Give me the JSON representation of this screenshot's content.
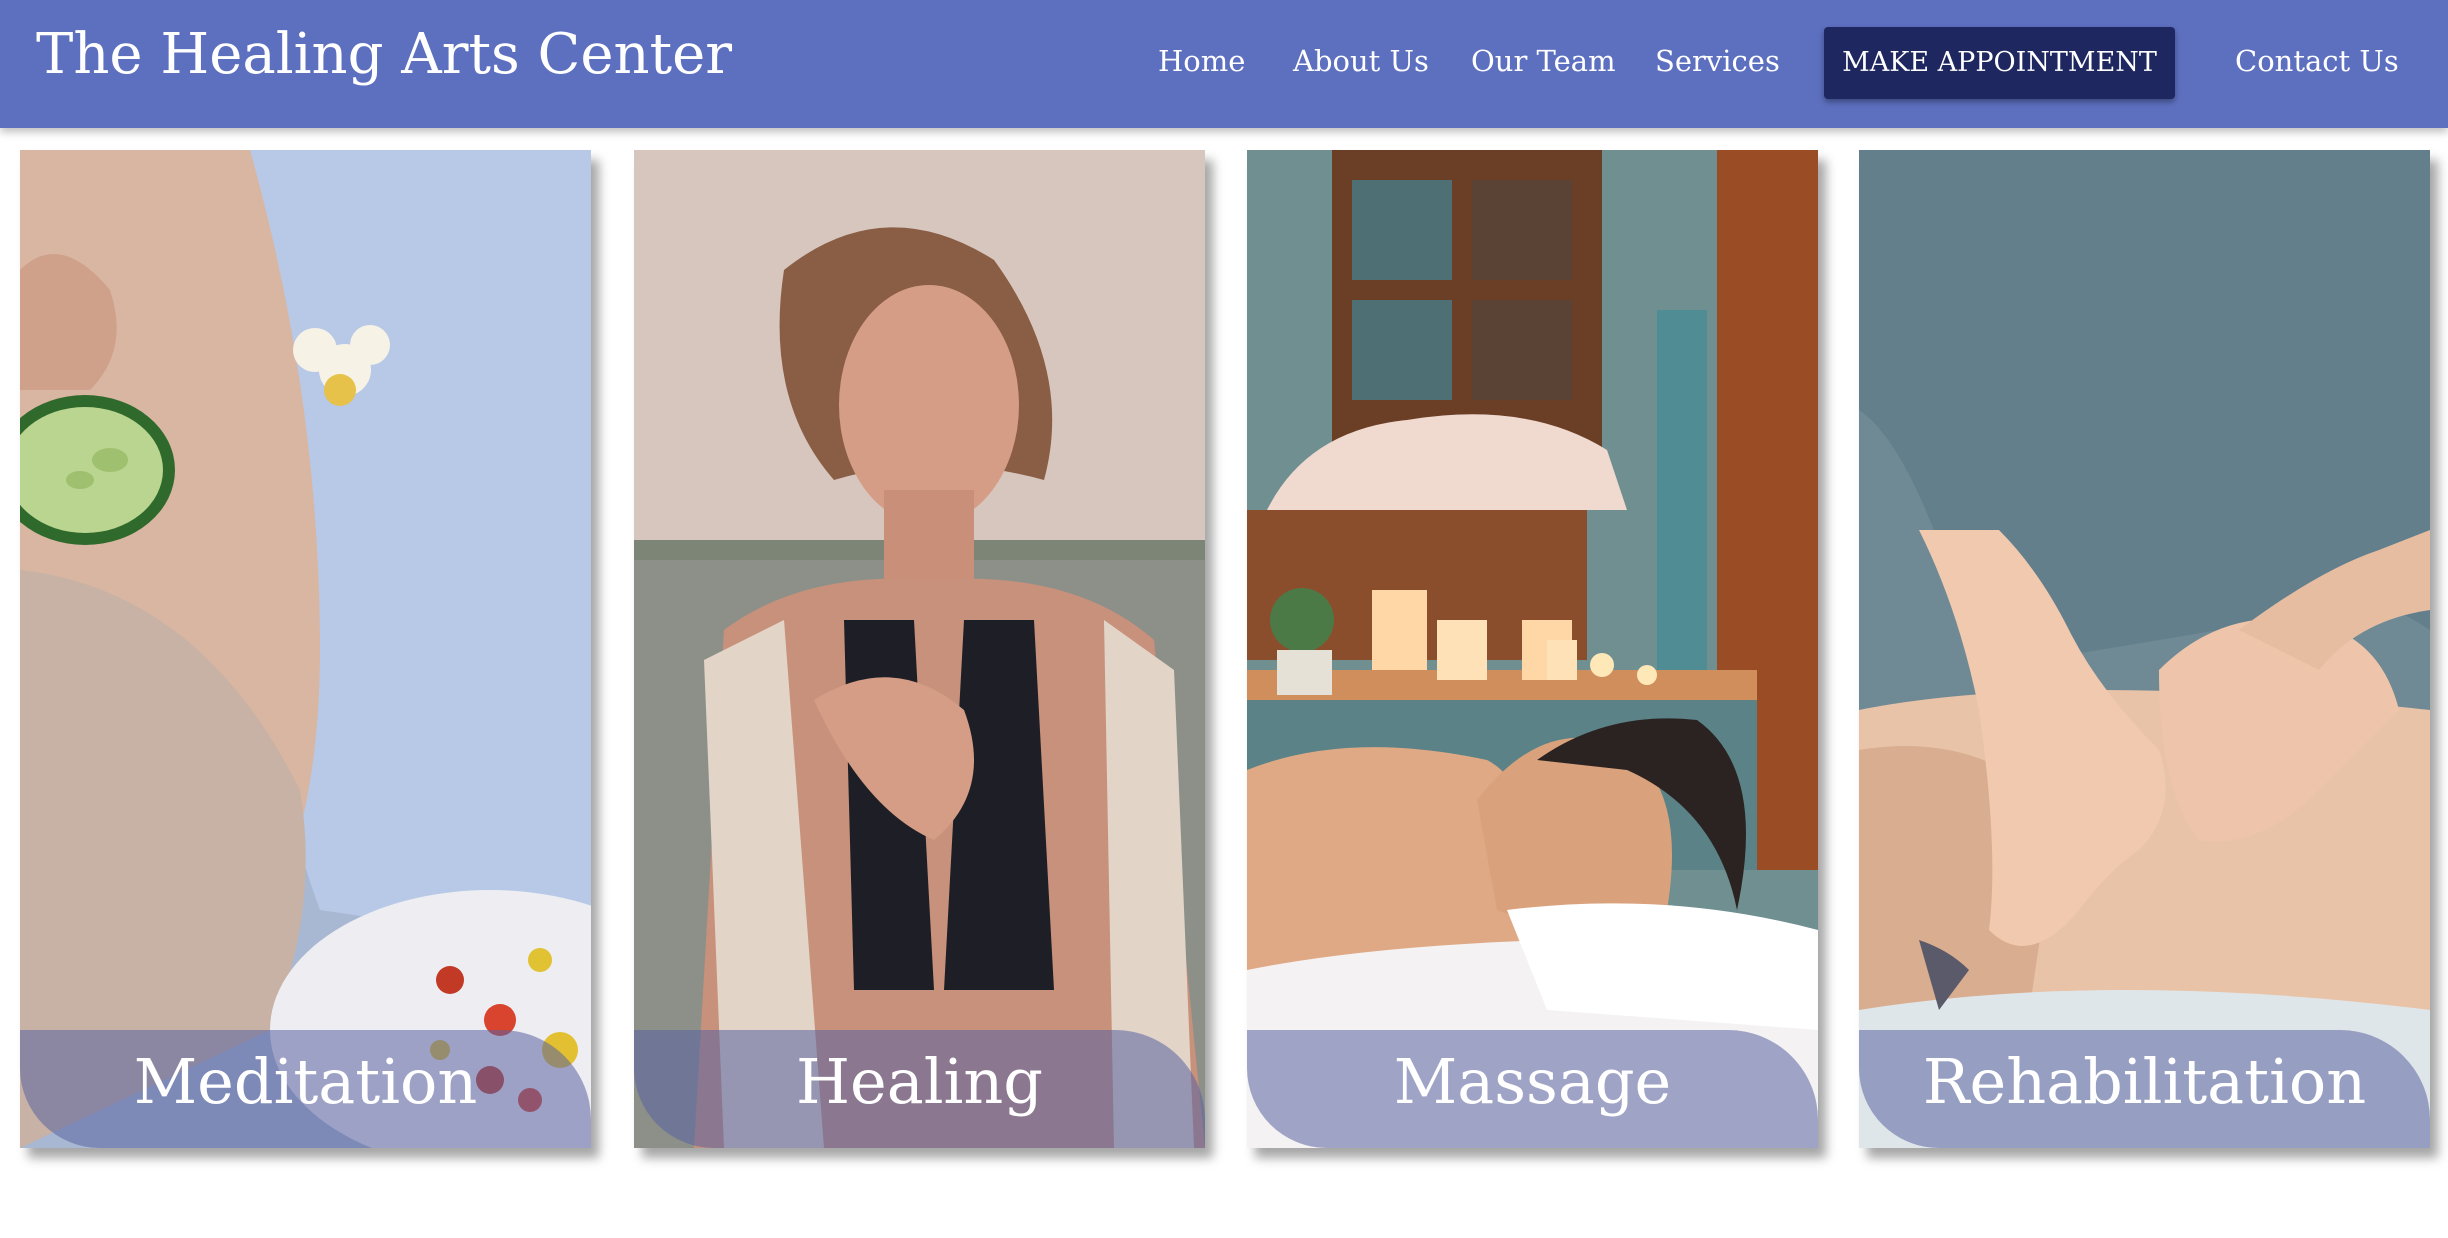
{
  "header": {
    "site_title": "The Healing Arts Center",
    "nav": {
      "home": "Home",
      "about": "About Us",
      "team": "Our Team",
      "services": "Services",
      "appointment": "MAKE APPOINTMENT",
      "contact": "Contact Us"
    }
  },
  "cards": [
    {
      "label": "Meditation"
    },
    {
      "label": "Healing"
    },
    {
      "label": "Massage"
    },
    {
      "label": "Rehabilitation"
    }
  ],
  "colors": {
    "header_bg": "#5d6fbf",
    "appointment_bg": "#1e275f",
    "caption_overlay": "rgba(90,98,160,0.55)",
    "text": "#ffffff"
  }
}
